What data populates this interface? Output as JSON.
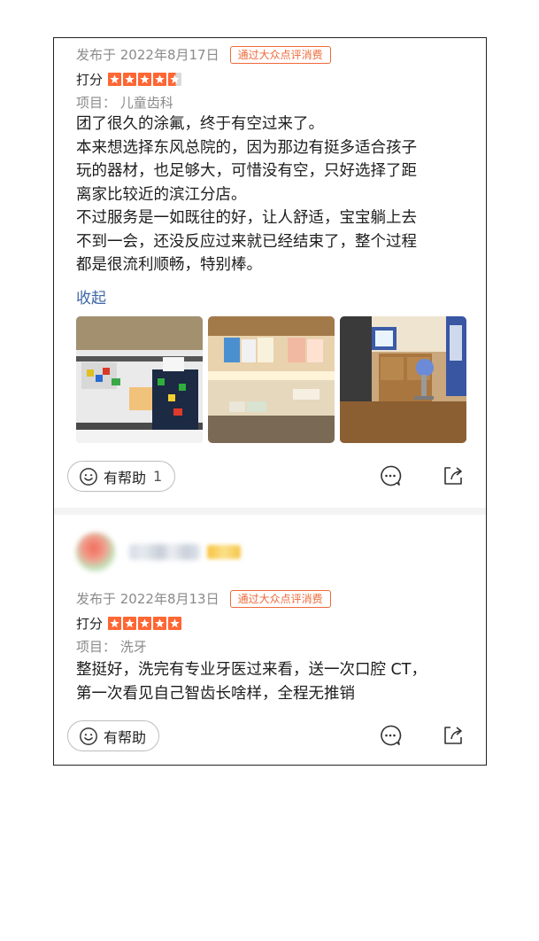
{
  "reviews": [
    {
      "date": "发布于 2022年8月17日",
      "badge": "通过大众点评消费",
      "score_label": "打分",
      "rating": 4.5,
      "item": "项目：  儿童齿科",
      "lines": [
        "团了很久的涂氟，终于有空过来了。",
        "本来想选择东风总院的，因为那边有挺多适合孩子",
        "玩的器材，也足够大，可惜没有空，只好选择了距",
        "离家比较近的滨江分店。",
        "不过服务是一如既往的好，让人舒适，宝宝躺上去",
        "不到一会，还没反应过来就已经结束了，整个过程",
        "都是很流利顺畅，特别棒。"
      ],
      "collapse_label": "收起",
      "helpful_label": "有帮助",
      "helpful_count": "1"
    },
    {
      "date": "发布于 2022年8月13日",
      "badge": "通过大众点评消费",
      "score_label": "打分",
      "rating": 5,
      "item": "项目：  洗牙",
      "lines": [
        "整挺好，洗完有专业牙医过来看，送一次口腔 CT，",
        "第一次看见自己智齿长啥样，全程无推销"
      ],
      "helpful_label": "有帮助"
    }
  ],
  "icons": {
    "helpful": "smile-icon",
    "comment": "comment-icon",
    "share": "share-icon",
    "star": "star-icon"
  },
  "colors": {
    "accent": "#ff6633",
    "badge": "#ef6a3a",
    "link": "#3f66a6"
  }
}
